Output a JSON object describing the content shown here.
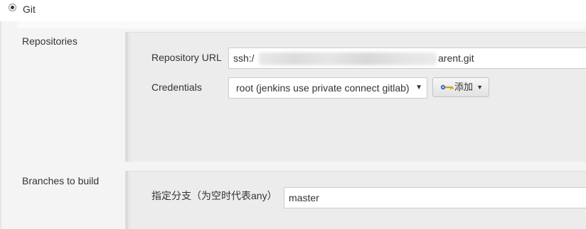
{
  "scm": {
    "option_label": "Git"
  },
  "repositories": {
    "section_label": "Repositories",
    "url_label": "Repository URL",
    "url_prefix": "ssh:/",
    "url_suffix": "arent.git",
    "credentials_label": "Credentials",
    "credentials_selected": "root (jenkins use private connect gitlab)",
    "add_button_label": "添加"
  },
  "branches": {
    "section_label": "Branches to build",
    "branch_label": "指定分支（为空时代表any）",
    "branch_value": "master"
  },
  "icons": {
    "radio": "radio-selected-icon",
    "key": "key-icon",
    "caret": "caret-down-icon"
  },
  "colors": {
    "panel_background": "#f4f4f4",
    "section_background": "#ececec",
    "section_bar": "#dcdcdc",
    "key_icon_blue": "#3b6fb6",
    "key_icon_gold": "#d4a017"
  }
}
